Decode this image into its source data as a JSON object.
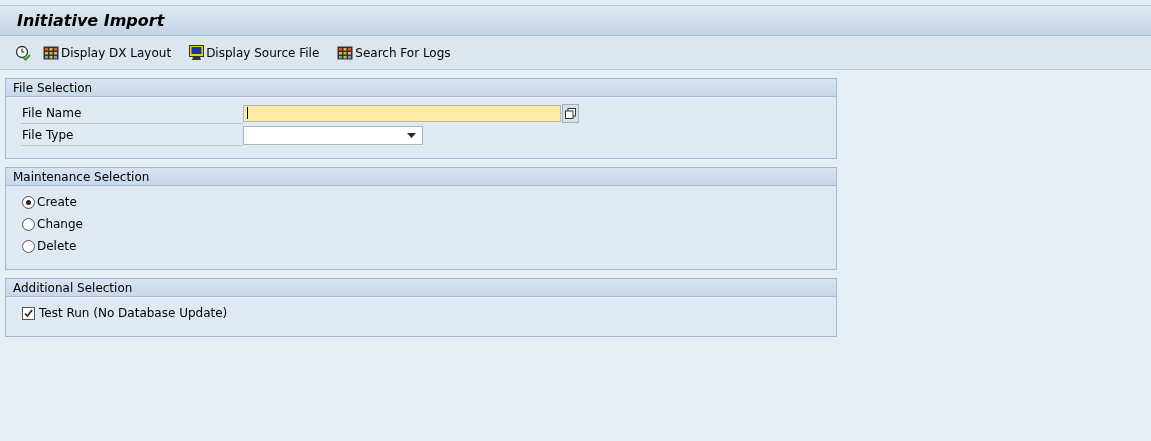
{
  "window": {
    "title": "Initiative Import"
  },
  "toolbar": [
    {
      "kind": "execute"
    },
    {
      "kind": "layout",
      "label": "Display DX Layout"
    },
    {
      "kind": "source",
      "label": "Display Source File"
    },
    {
      "kind": "logs",
      "label": "Search For Logs"
    }
  ],
  "sections": [
    {
      "title": "File Selection",
      "kind": "fields",
      "fields": [
        {
          "kind": "text",
          "label": "File Name",
          "focused": true
        },
        {
          "kind": "dropdown",
          "label": "File Type",
          "focused": false
        }
      ]
    },
    {
      "title": "Maintenance Selection",
      "kind": "radios",
      "options": [
        {
          "label": "Create",
          "selected": true
        },
        {
          "label": "Change",
          "selected": false
        },
        {
          "label": "Delete",
          "selected": false
        }
      ]
    },
    {
      "title": "Additional Selection",
      "kind": "checks",
      "options": [
        {
          "label": "Test Run (No Database Update)",
          "checked": true
        }
      ]
    }
  ]
}
